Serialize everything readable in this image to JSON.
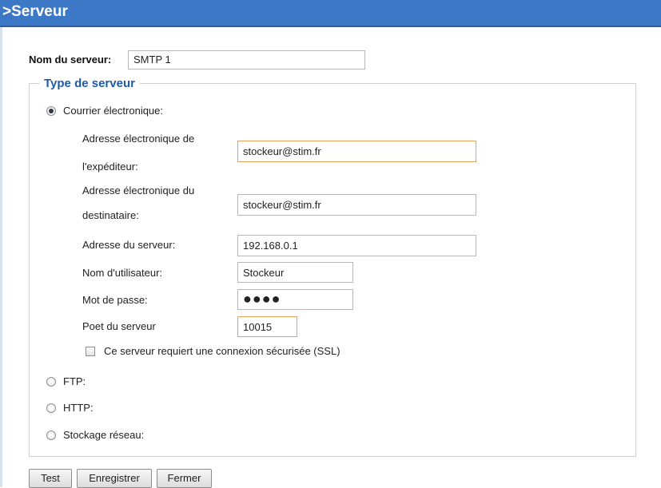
{
  "header": {
    "title": ">Serveur"
  },
  "server_name": {
    "label": "Nom du serveur:",
    "value": "SMTP 1"
  },
  "server_type": {
    "legend": "Type de serveur",
    "email": {
      "label": "Courrier électronique:",
      "selected": true,
      "sender": {
        "label_line1": "Adresse électronique de",
        "label_line2": "l'expéditeur:",
        "value": "stockeur@stim.fr"
      },
      "recipient": {
        "label_line1": "Adresse électronique du",
        "label_line2": "destinataire:",
        "value": "stockeur@stim.fr"
      },
      "server_address": {
        "label": "Adresse du serveur:",
        "value": "192.168.0.1"
      },
      "username": {
        "label": "Nom d'utilisateur:",
        "value": "Stockeur"
      },
      "password": {
        "label": "Mot de passe:",
        "value": "●●●●"
      },
      "port": {
        "label": "Poet du serveur",
        "value": "10015"
      },
      "ssl": {
        "label": "Ce serveur requiert une connexion sécurisée (SSL)",
        "checked": false
      }
    },
    "ftp": {
      "label": "FTP:",
      "selected": false
    },
    "http": {
      "label": "HTTP:",
      "selected": false
    },
    "network_storage": {
      "label": "Stockage réseau:",
      "selected": false
    }
  },
  "buttons": {
    "test": "Test",
    "save": "Enregistrer",
    "close": "Fermer"
  },
  "colors": {
    "header_bg": "#3d78c6",
    "legend_text": "#1f5aa6",
    "focus_border": "#e8a25b"
  }
}
